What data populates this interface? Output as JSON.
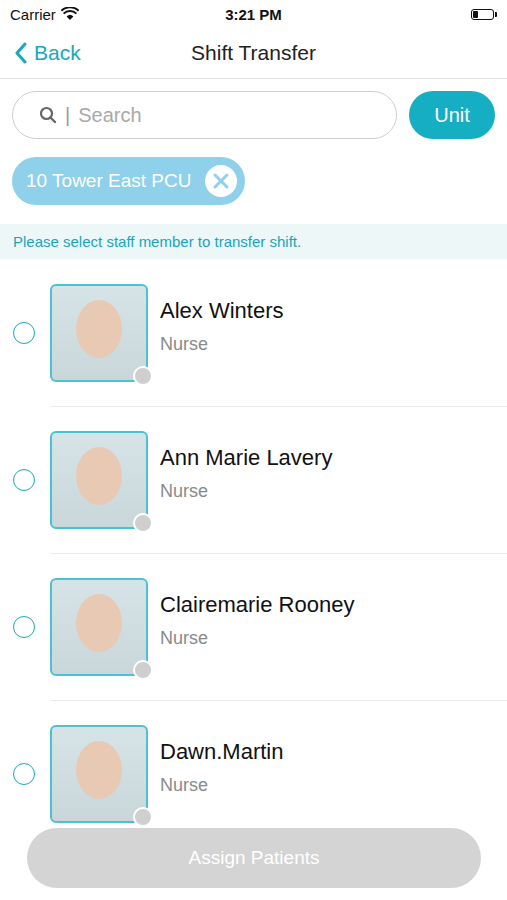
{
  "status_bar": {
    "carrier": "Carrier",
    "time": "3:21 PM",
    "battery_level": 0.25
  },
  "nav": {
    "back": "Back",
    "title": "Shift Transfer"
  },
  "search": {
    "cursor": "|",
    "placeholder": "Search"
  },
  "unit_button": "Unit",
  "filters": [
    {
      "label": "10 Tower East PCU"
    }
  ],
  "instruction": "Please select staff member to transfer shift.",
  "staff": [
    {
      "name": "Alex Winters",
      "role": "Nurse",
      "selected": false,
      "online": false
    },
    {
      "name": "Ann Marie Lavery",
      "role": "Nurse",
      "selected": false,
      "online": false
    },
    {
      "name": "Clairemarie Rooney",
      "role": "Nurse",
      "selected": false,
      "online": false
    },
    {
      "name": "Dawn.Martin",
      "role": "Nurse",
      "selected": false,
      "online": false
    }
  ],
  "assign_button": {
    "label": "Assign Patients",
    "disabled": true
  }
}
